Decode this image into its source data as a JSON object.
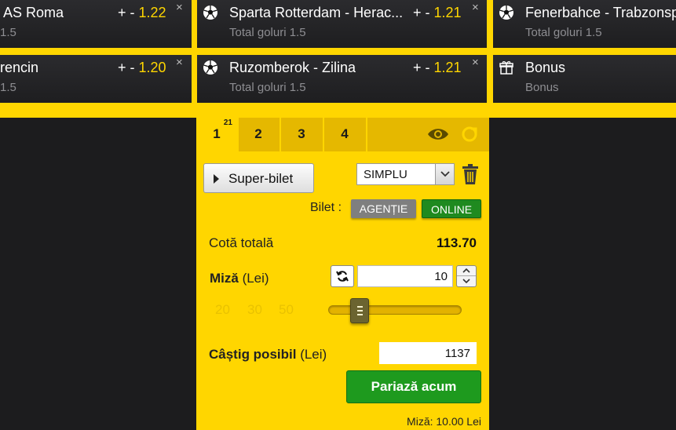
{
  "bet_cards": [
    {
      "title": "AS Roma",
      "subtitle": "1.5",
      "odds_prefix": "+ -",
      "odds": "1.22",
      "icon": "soccer-ball-icon"
    },
    {
      "title": "Sparta Rotterdam - Herac...",
      "subtitle": "Total goluri 1.5",
      "odds_prefix": "+ -",
      "odds": "1.21",
      "icon": "soccer-ball-icon"
    },
    {
      "title": "Fenerbahce - Trabzonsp",
      "subtitle": "Total goluri 1.5",
      "icon": "soccer-ball-icon"
    },
    {
      "title": "rencin",
      "subtitle": "1.5",
      "odds_prefix": "+ -",
      "odds": "1.20",
      "icon": "soccer-ball-icon"
    },
    {
      "title": "Ruzomberok - Zilina",
      "subtitle": "Total goluri 1.5",
      "odds_prefix": "+ -",
      "odds": "1.21",
      "icon": "soccer-ball-icon"
    },
    {
      "title": "Bonus",
      "subtitle": "Bonus",
      "icon": "gift-icon"
    }
  ],
  "close_symbol": "×",
  "slip": {
    "tabs": [
      {
        "label": "1",
        "badge": "21"
      },
      {
        "label": "2"
      },
      {
        "label": "3"
      },
      {
        "label": "4"
      }
    ],
    "super_bilet_label": "Super-bilet",
    "bet_type_value": "SIMPLU",
    "bilet_label": "Bilet :",
    "agentie_label": "AGENȚIE",
    "online_label": "ONLINE",
    "cota_label": "Cotă totală",
    "cota_value": "113.70",
    "miza_label_bold": "Miză",
    "miza_label_unit": " (Lei)",
    "miza_value": "10",
    "quick_stakes": [
      "20",
      "30",
      "50"
    ],
    "castig_label_bold": "Câștig posibil",
    "castig_label_unit": " (Lei)",
    "castig_value": "1137",
    "pariaza_label": "Pariază acum",
    "miza_footer": "Miză: 10.00 Lei"
  },
  "colors": {
    "accent": "#ffd600",
    "dark_bg": "#1c1c1e",
    "go_green": "#1e9a1e",
    "agentie_gray": "#7f7f7f"
  }
}
